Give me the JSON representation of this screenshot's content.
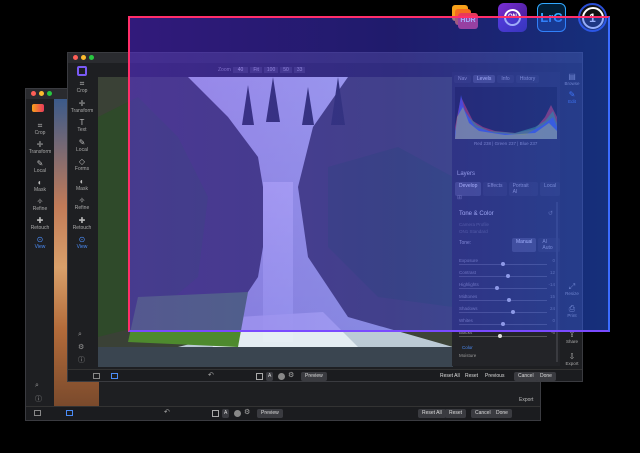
{
  "app_icons": {
    "hdr_label": "HDR",
    "on1_label": "ON",
    "lrc_label": "LrC",
    "c1_label": "1"
  },
  "back_window": {
    "tools": [
      {
        "label": "Crop",
        "icon": "crop-icon"
      },
      {
        "label": "Transform",
        "icon": "transform-icon"
      },
      {
        "label": "Local",
        "icon": "brush-icon"
      },
      {
        "label": "Mask",
        "icon": "mask-icon"
      },
      {
        "label": "Refine",
        "icon": "refine-icon"
      },
      {
        "label": "Retouch",
        "icon": "retouch-icon"
      },
      {
        "label": "View",
        "icon": "view-icon"
      }
    ],
    "bottom": {
      "preview": "Preview",
      "reset_all": "Reset All",
      "reset": "Reset",
      "cancel": "Cancel",
      "done": "Done",
      "a_label": "A"
    },
    "export_label": "Export"
  },
  "mid_window": {
    "tools": [
      {
        "label": "Crop",
        "icon": "crop-icon"
      },
      {
        "label": "Transform",
        "icon": "transform-icon"
      },
      {
        "label": "Text",
        "icon": "text-icon"
      },
      {
        "label": "Local",
        "icon": "brush-icon"
      },
      {
        "label": "Forms",
        "icon": "forms-icon"
      },
      {
        "label": "Mask",
        "icon": "mask-icon"
      },
      {
        "label": "Refine",
        "icon": "refine-icon"
      },
      {
        "label": "Retouch",
        "icon": "retouch-icon"
      },
      {
        "label": "View",
        "icon": "view-icon"
      }
    ],
    "zoom": {
      "label": "Zoom",
      "value": "40",
      "options": [
        "Fit",
        "100",
        "50",
        "33"
      ]
    },
    "bottom": {
      "preview": "Preview",
      "reset_all": "Reset All",
      "reset": "Reset",
      "previous": "Previous",
      "cancel": "Cancel",
      "done": "Done",
      "a_label": "A"
    }
  },
  "right_panel": {
    "top_tabs": [
      {
        "label": "Nav",
        "selected": false
      },
      {
        "label": "Levels",
        "selected": true
      },
      {
        "label": "Info",
        "selected": false
      },
      {
        "label": "History",
        "selected": false
      }
    ],
    "rgb_readout": "Red 238 | Green 237 | Blue 237",
    "layers_label": "Layers",
    "module_tabs": [
      {
        "label": "Develop",
        "selected": true
      },
      {
        "label": "Effects",
        "selected": false
      },
      {
        "label": "Portrait AI",
        "selected": false
      },
      {
        "label": "Local",
        "selected": false
      }
    ],
    "section_title": "Tone & Color",
    "sub_labels": [
      "Camera Profile",
      "ON1 Standard"
    ],
    "tone_label": "Tone:",
    "tone_modes": [
      {
        "label": "Manual",
        "selected": true
      },
      {
        "label": "AI Auto",
        "selected": false
      }
    ],
    "sliders": [
      {
        "label": "Exposure",
        "value": "0",
        "level": 0.5
      },
      {
        "label": "Contrast",
        "value": "12",
        "level": 0.56
      },
      {
        "label": "Highlights",
        "value": "-14",
        "level": 0.43
      },
      {
        "label": "Midtones",
        "value": "15",
        "level": 0.57
      },
      {
        "label": "Shadows",
        "value": "24",
        "level": 0.62
      },
      {
        "label": "Whites",
        "value": "0",
        "level": 0.5
      },
      {
        "label": "Blacks",
        "value": "-6",
        "level": 0.47
      }
    ],
    "color_label": "Color",
    "moisture_label": "Moisture",
    "side_tools": [
      {
        "label": "Browse",
        "icon": "browse-icon"
      },
      {
        "label": "Edit",
        "icon": "edit-icon"
      },
      {
        "label": "Resize",
        "icon": "resize-icon"
      },
      {
        "label": "Print",
        "icon": "print-icon"
      },
      {
        "label": "Share",
        "icon": "share-icon"
      },
      {
        "label": "Export",
        "icon": "export-icon"
      }
    ]
  },
  "colors": {
    "accent": "#4b8cf7",
    "overlay_start": "#5a2fe0",
    "overlay_end": "#2a5ff5",
    "overlay_border": "#ff2e6a"
  }
}
